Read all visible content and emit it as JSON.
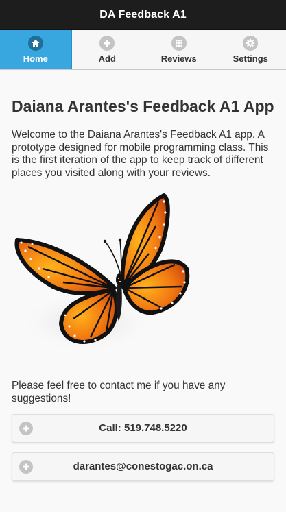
{
  "header": {
    "title": "DA Feedback A1"
  },
  "navbar": {
    "items": [
      {
        "label": "Home",
        "icon": "home-icon",
        "active": true
      },
      {
        "label": "Add",
        "icon": "plus-icon",
        "active": false
      },
      {
        "label": "Reviews",
        "icon": "grid-icon",
        "active": false
      },
      {
        "label": "Settings",
        "icon": "gear-icon",
        "active": false
      }
    ]
  },
  "main": {
    "title": "Daiana Arantes's Feedback A1 App",
    "intro": "Welcome to the Daiana Arantes's Feedback A1 app. A prototype designed for mobile programming class. This is the first iteration of the app to keep track of different places you visited along with your reviews.",
    "image": "monarch-butterfly",
    "contact_text": "Please feel free to contact me if you have any suggestions!",
    "phone_button": "Call: 519.748.5220",
    "email_button": "darantes@conestogac.on.ca"
  },
  "colors": {
    "header_bg": "#1d1d1d",
    "active_tab": "#38a7e0",
    "page_bg": "#f9f9f9"
  }
}
